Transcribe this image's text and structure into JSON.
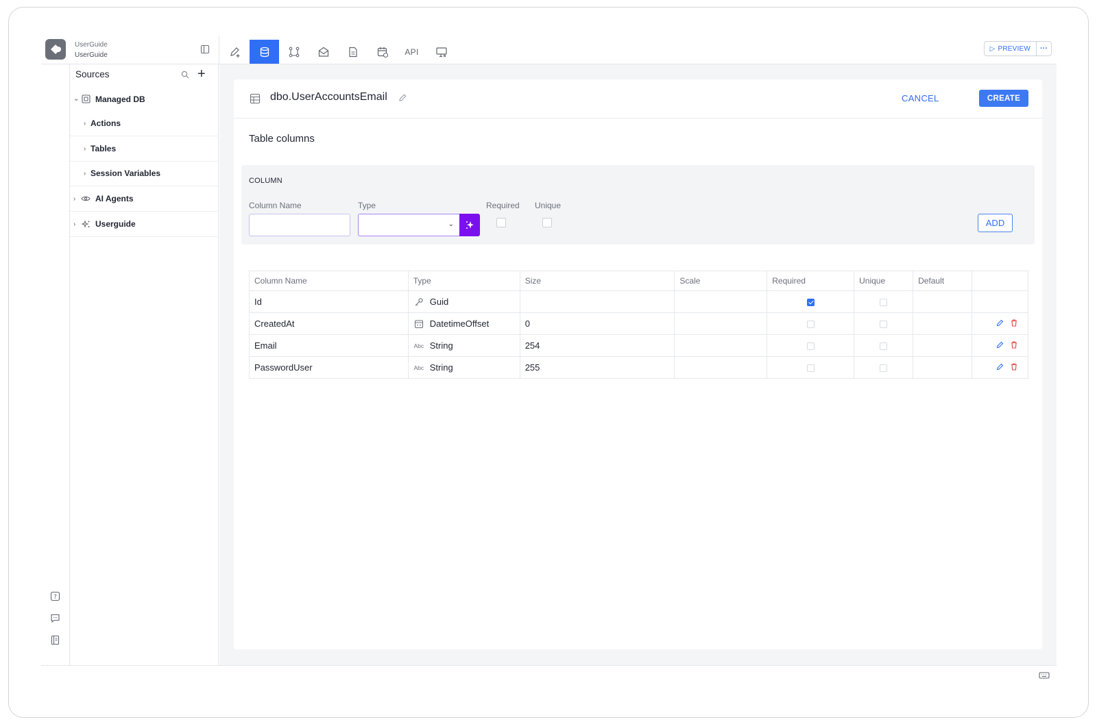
{
  "header": {
    "project_line1": "UserGuide",
    "project_line2": "UserGuide",
    "toolbar": [
      "edit-tool-icon",
      "database-icon",
      "workflow-icon",
      "mail-icon",
      "document-icon",
      "calendar-icon",
      "API",
      "preview-screen-icon"
    ],
    "toolbar_api_label": "API",
    "preview_label": "PREVIEW",
    "more_label": "···"
  },
  "sidebar": {
    "title": "Sources",
    "items": [
      {
        "label": "Managed DB",
        "icon": "database-box-icon"
      },
      {
        "label": "Actions"
      },
      {
        "label": "Tables"
      },
      {
        "label": "Session Variables"
      },
      {
        "label": "AI Agents",
        "icon": "eye-icon"
      },
      {
        "label": "Userguide",
        "icon": "sparkle-icon"
      }
    ]
  },
  "editor": {
    "table_name": "dbo.UserAccountsEmail",
    "cancel_label": "CANCEL",
    "create_label": "CREATE",
    "section_title": "Table columns"
  },
  "column_form": {
    "heading": "COLUMN",
    "name_label": "Column Name",
    "type_label": "Type",
    "required_label": "Required",
    "unique_label": "Unique",
    "name_value": "",
    "type_value": "",
    "add_label": "ADD"
  },
  "columns_table": {
    "headers": [
      "Column Name",
      "Type",
      "Size",
      "Scale",
      "Required",
      "Unique",
      "Default",
      ""
    ],
    "rows": [
      {
        "name": "Id",
        "type": "Guid",
        "type_icon": "key-icon",
        "size": "",
        "scale": "",
        "required": true,
        "unique": false,
        "default": "",
        "actions": false
      },
      {
        "name": "CreatedAt",
        "type": "DatetimeOffset",
        "type_icon": "datetime-icon",
        "size": "0",
        "scale": "",
        "required": false,
        "unique": false,
        "default": "",
        "actions": true
      },
      {
        "name": "Email",
        "type": "String",
        "type_icon": "Abc",
        "size": "254",
        "scale": "",
        "required": false,
        "unique": false,
        "default": "",
        "actions": true
      },
      {
        "name": "PasswordUser",
        "type": "String",
        "type_icon": "Abc",
        "size": "255",
        "scale": "",
        "required": false,
        "unique": false,
        "default": "",
        "actions": true
      }
    ]
  },
  "colors": {
    "accent": "#2f6ff3",
    "ai_button": "#7a10ee",
    "delete": "#e0453a"
  }
}
